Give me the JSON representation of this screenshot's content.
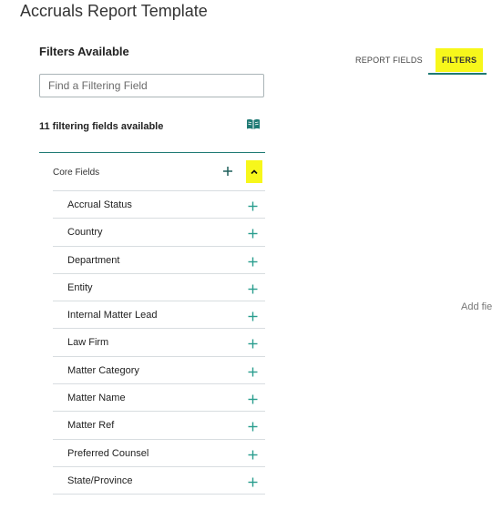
{
  "page": {
    "title": "Accruals Report Template"
  },
  "filters_panel": {
    "title": "Filters Available",
    "search_placeholder": "Find a Filtering Field",
    "count_text": "11 filtering fields available",
    "group": {
      "label": "Core Fields",
      "fields": [
        "Accrual Status",
        "Country",
        "Department",
        "Entity",
        "Internal Matter Lead",
        "Law Firm",
        "Matter Category",
        "Matter Name",
        "Matter Ref",
        "Preferred Counsel",
        "State/Province"
      ]
    }
  },
  "tabs": {
    "report_fields": "REPORT FIELDS",
    "filters": "FILTERS",
    "active": "filters"
  },
  "right_panel": {
    "hint_text": "Add fie"
  },
  "colors": {
    "accent": "#1f7a74",
    "highlight": "#f7f71b"
  },
  "icons": {
    "book": "book-open-icon",
    "add": "plus-icon",
    "collapse": "chevron-up-icon"
  }
}
